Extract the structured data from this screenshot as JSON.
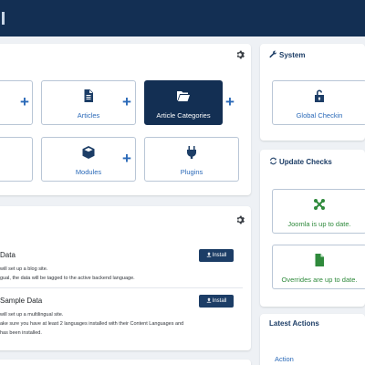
{
  "topbar": {
    "bg": "#132f53"
  },
  "colors": {
    "accent": "#2a69b8",
    "dark": "#132f53",
    "success": "#2f8a3c"
  },
  "quick_tiles": [
    {
      "label": "",
      "icon": "partial-tile",
      "add": true
    },
    {
      "label": "Articles",
      "icon": "file-icon",
      "add": true
    },
    {
      "label": "Article Categories",
      "icon": "folder-open-icon",
      "add": true,
      "active": true
    },
    {
      "label": "",
      "icon": "partial-tile",
      "add": false
    },
    {
      "label": "Modules",
      "icon": "cube-icon",
      "add": true
    },
    {
      "label": "Plugins",
      "icon": "plug-icon",
      "add": false
    }
  ],
  "system": {
    "title": "System",
    "title_icon": "wrench-icon",
    "tiles": [
      {
        "label": "Global Checkin",
        "icon": "unlock-icon"
      }
    ]
  },
  "update_checks": {
    "title": "Update Checks",
    "title_icon": "sync-icon",
    "tiles": [
      {
        "label": "Joomla is up to date.",
        "icon": "joomla-icon"
      },
      {
        "label": "Overrides are up to date.",
        "icon": "file-green-icon"
      }
    ]
  },
  "sample_data": {
    "items": [
      {
        "heading": "Data",
        "lines": [
          "will set up a blog site.",
          "gual, the data will be tagged to the active backend language."
        ],
        "button": "Install"
      },
      {
        "heading": "Sample Data",
        "lines": [
          "will set up a multilingual site.",
          "ake sure you have at least 2 languages installed with their Content Languages and",
          "has been installed."
        ],
        "button": "Install"
      }
    ]
  },
  "latest_actions": {
    "title": "Latest Actions",
    "column": "Action"
  }
}
